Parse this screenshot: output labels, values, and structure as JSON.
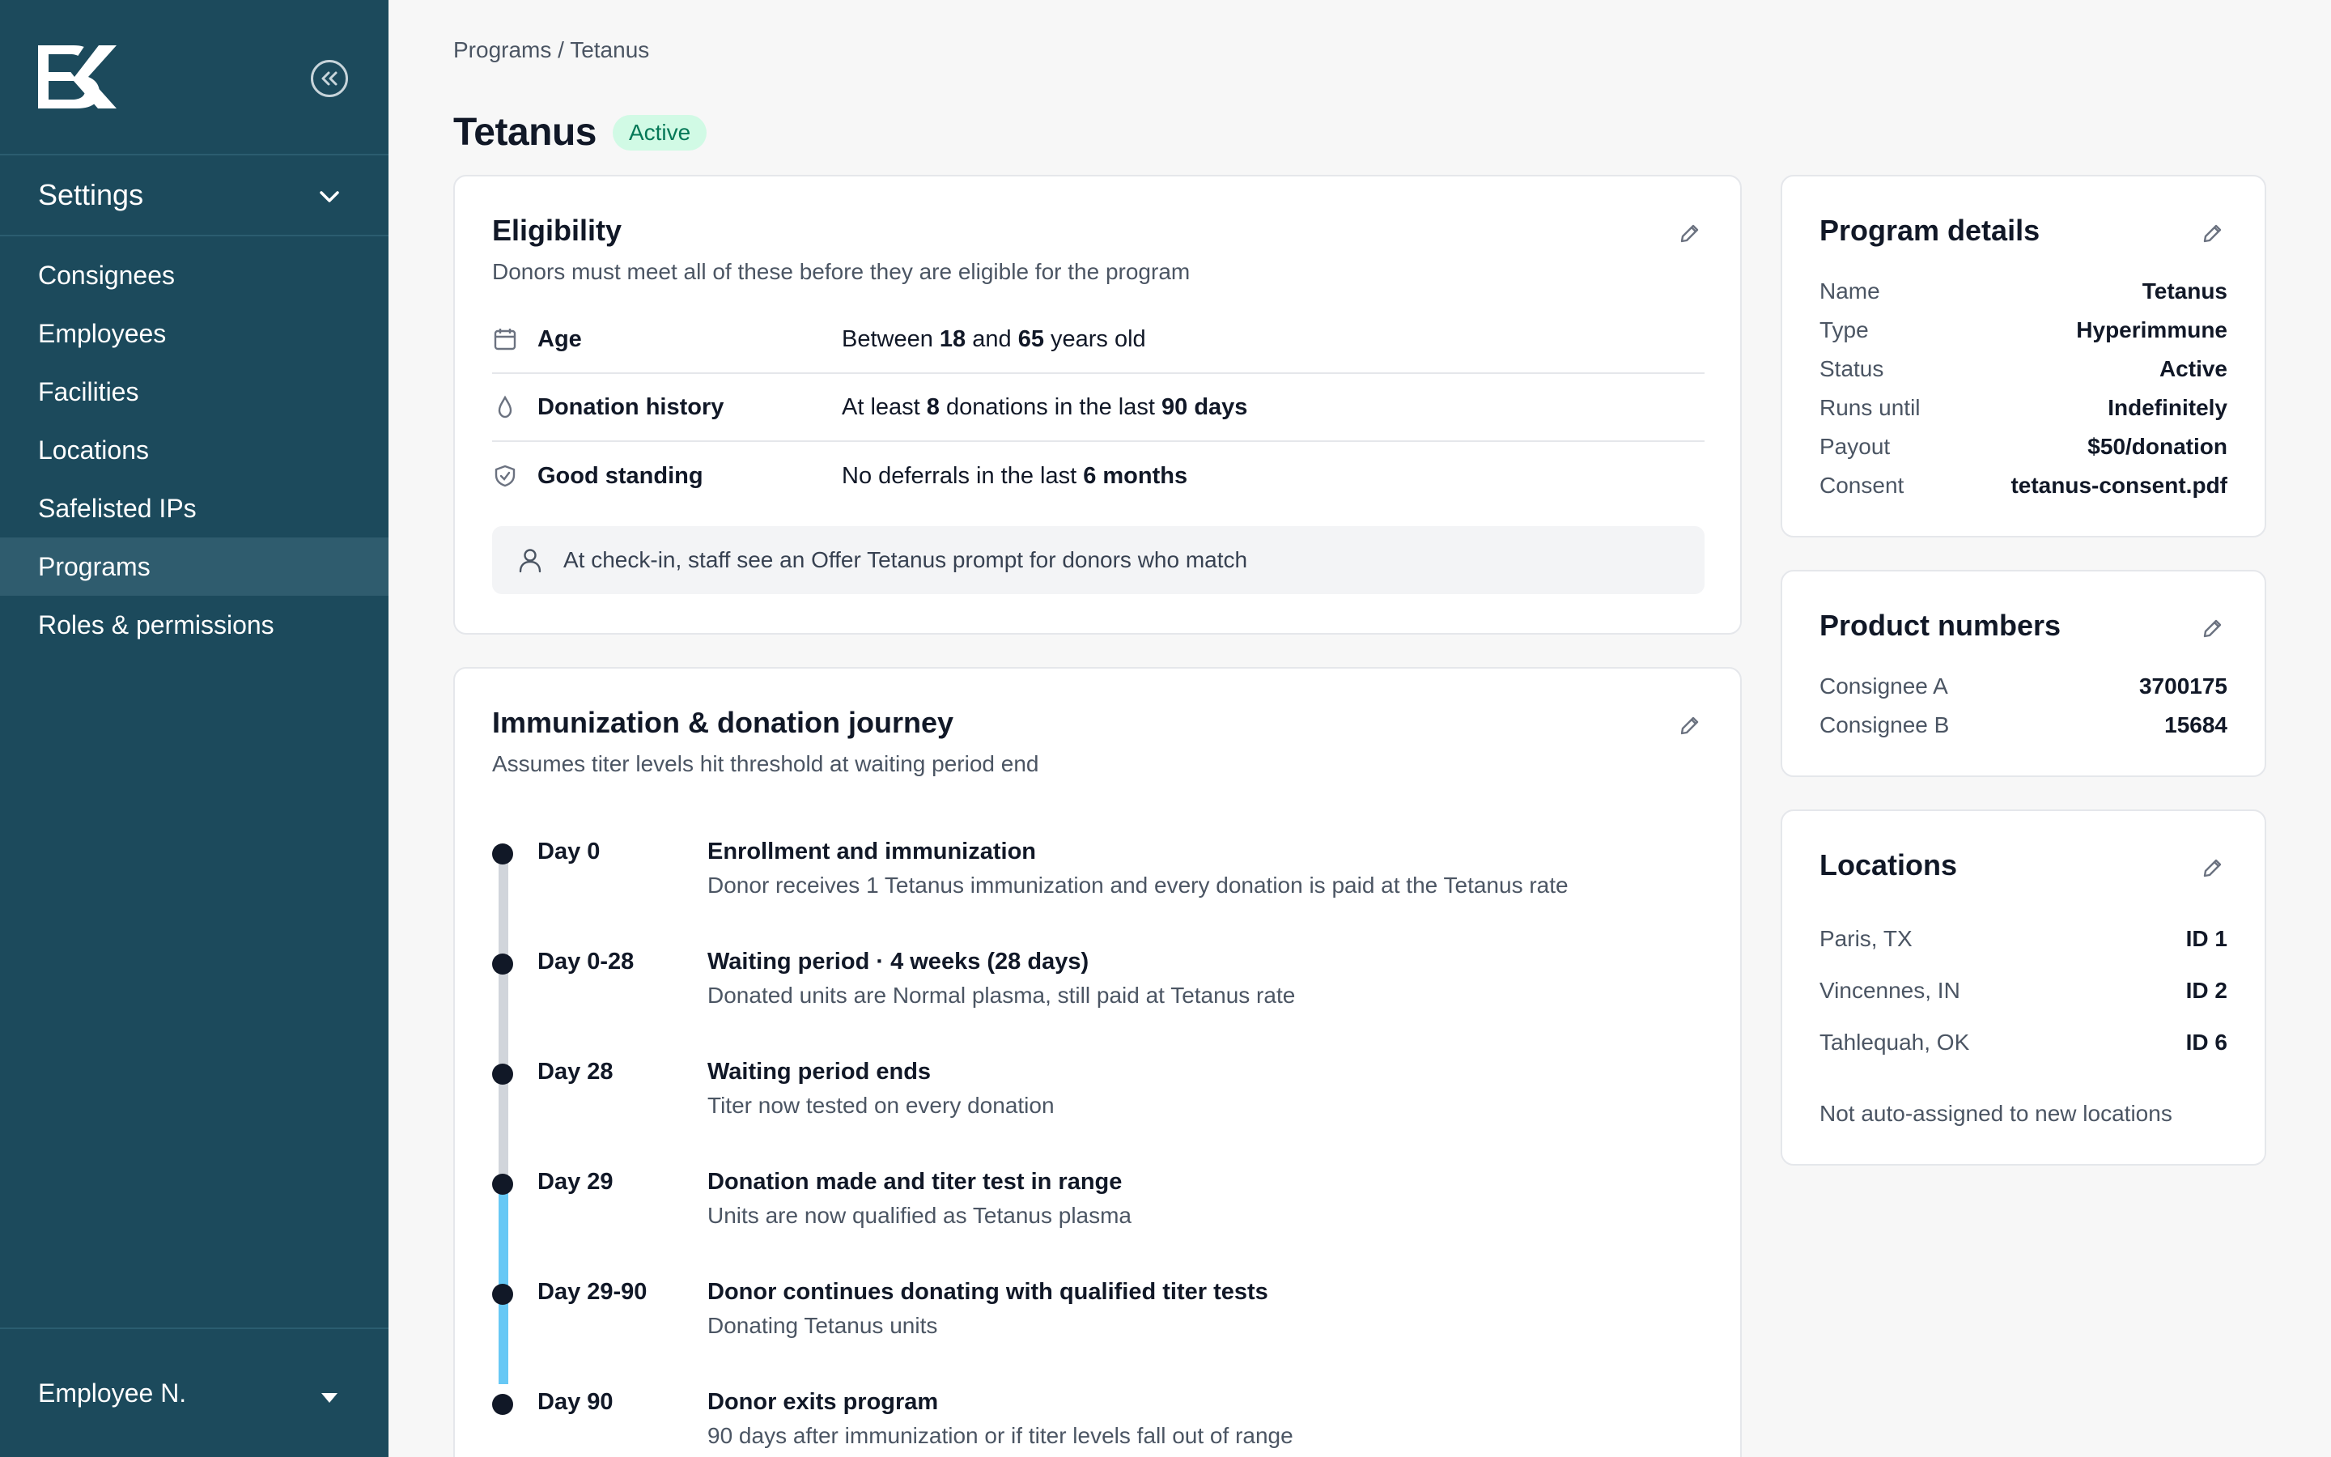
{
  "sidebar": {
    "settings_label": "Settings",
    "nav": [
      "Consignees",
      "Employees",
      "Facilities",
      "Locations",
      "Safelisted IPs",
      "Programs",
      "Roles & permissions"
    ],
    "active_index": 5,
    "user_label": "Employee N."
  },
  "breadcrumb": "Programs / Tetanus",
  "page": {
    "title": "Tetanus",
    "status": "Active"
  },
  "eligibility": {
    "title": "Eligibility",
    "subtitle": "Donors must meet all of these before they are eligible for the program",
    "rows": [
      {
        "icon": "calendar-icon",
        "name": "Age",
        "parts": [
          "Between ",
          "18",
          " and ",
          "65",
          " years old"
        ]
      },
      {
        "icon": "droplet-icon",
        "name": "Donation history",
        "parts": [
          "At least ",
          "8",
          " donations in the last ",
          "90 days",
          ""
        ]
      },
      {
        "icon": "shield-check-icon",
        "name": "Good standing",
        "parts": [
          "No deferrals in the last ",
          "6 months",
          "",
          "",
          ""
        ]
      }
    ],
    "note": "At check-in, staff see an Offer Tetanus prompt for donors who match"
  },
  "journey": {
    "title": "Immunization & donation journey",
    "subtitle": "Assumes titer levels hit threshold at waiting period end",
    "steps": [
      {
        "day": "Day 0",
        "title": "Enrollment and immunization",
        "desc": "Donor receives 1 Tetanus immunization and every donation is paid at the Tetanus rate"
      },
      {
        "day": "Day 0-28",
        "title": "Waiting period · 4 weeks (28 days)",
        "desc": "Donated units are Normal plasma, still paid at Tetanus rate"
      },
      {
        "day": "Day 28",
        "title": "Waiting period ends",
        "desc": "Titer now tested on every donation"
      },
      {
        "day": "Day 29",
        "title": "Donation made and titer test in range",
        "desc": "Units are now qualified as Tetanus plasma"
      },
      {
        "day": "Day 29-90",
        "title": "Donor continues donating with qualified titer tests",
        "desc": "Donating Tetanus units"
      },
      {
        "day": "Day 90",
        "title": "Donor exits program",
        "desc": "90 days after immunization or if titer levels fall out of range"
      }
    ]
  },
  "details": {
    "title": "Program details",
    "rows": [
      {
        "k": "Name",
        "v": "Tetanus"
      },
      {
        "k": "Type",
        "v": "Hyperimmune"
      },
      {
        "k": "Status",
        "v": "Active"
      },
      {
        "k": "Runs until",
        "v": "Indefinitely"
      },
      {
        "k": "Payout",
        "v": "$50/donation"
      },
      {
        "k": "Consent",
        "v": "tetanus-consent.pdf"
      }
    ]
  },
  "products": {
    "title": "Product numbers",
    "rows": [
      {
        "k": "Consignee A",
        "v": "3700175"
      },
      {
        "k": "Consignee B",
        "v": "15684"
      }
    ]
  },
  "locations": {
    "title": "Locations",
    "rows": [
      {
        "k": "Paris, TX",
        "v": "ID 1"
      },
      {
        "k": "Vincennes, IN",
        "v": "ID 2"
      },
      {
        "k": "Tahlequah, OK",
        "v": "ID 6"
      }
    ],
    "note": "Not auto-assigned to new locations"
  }
}
